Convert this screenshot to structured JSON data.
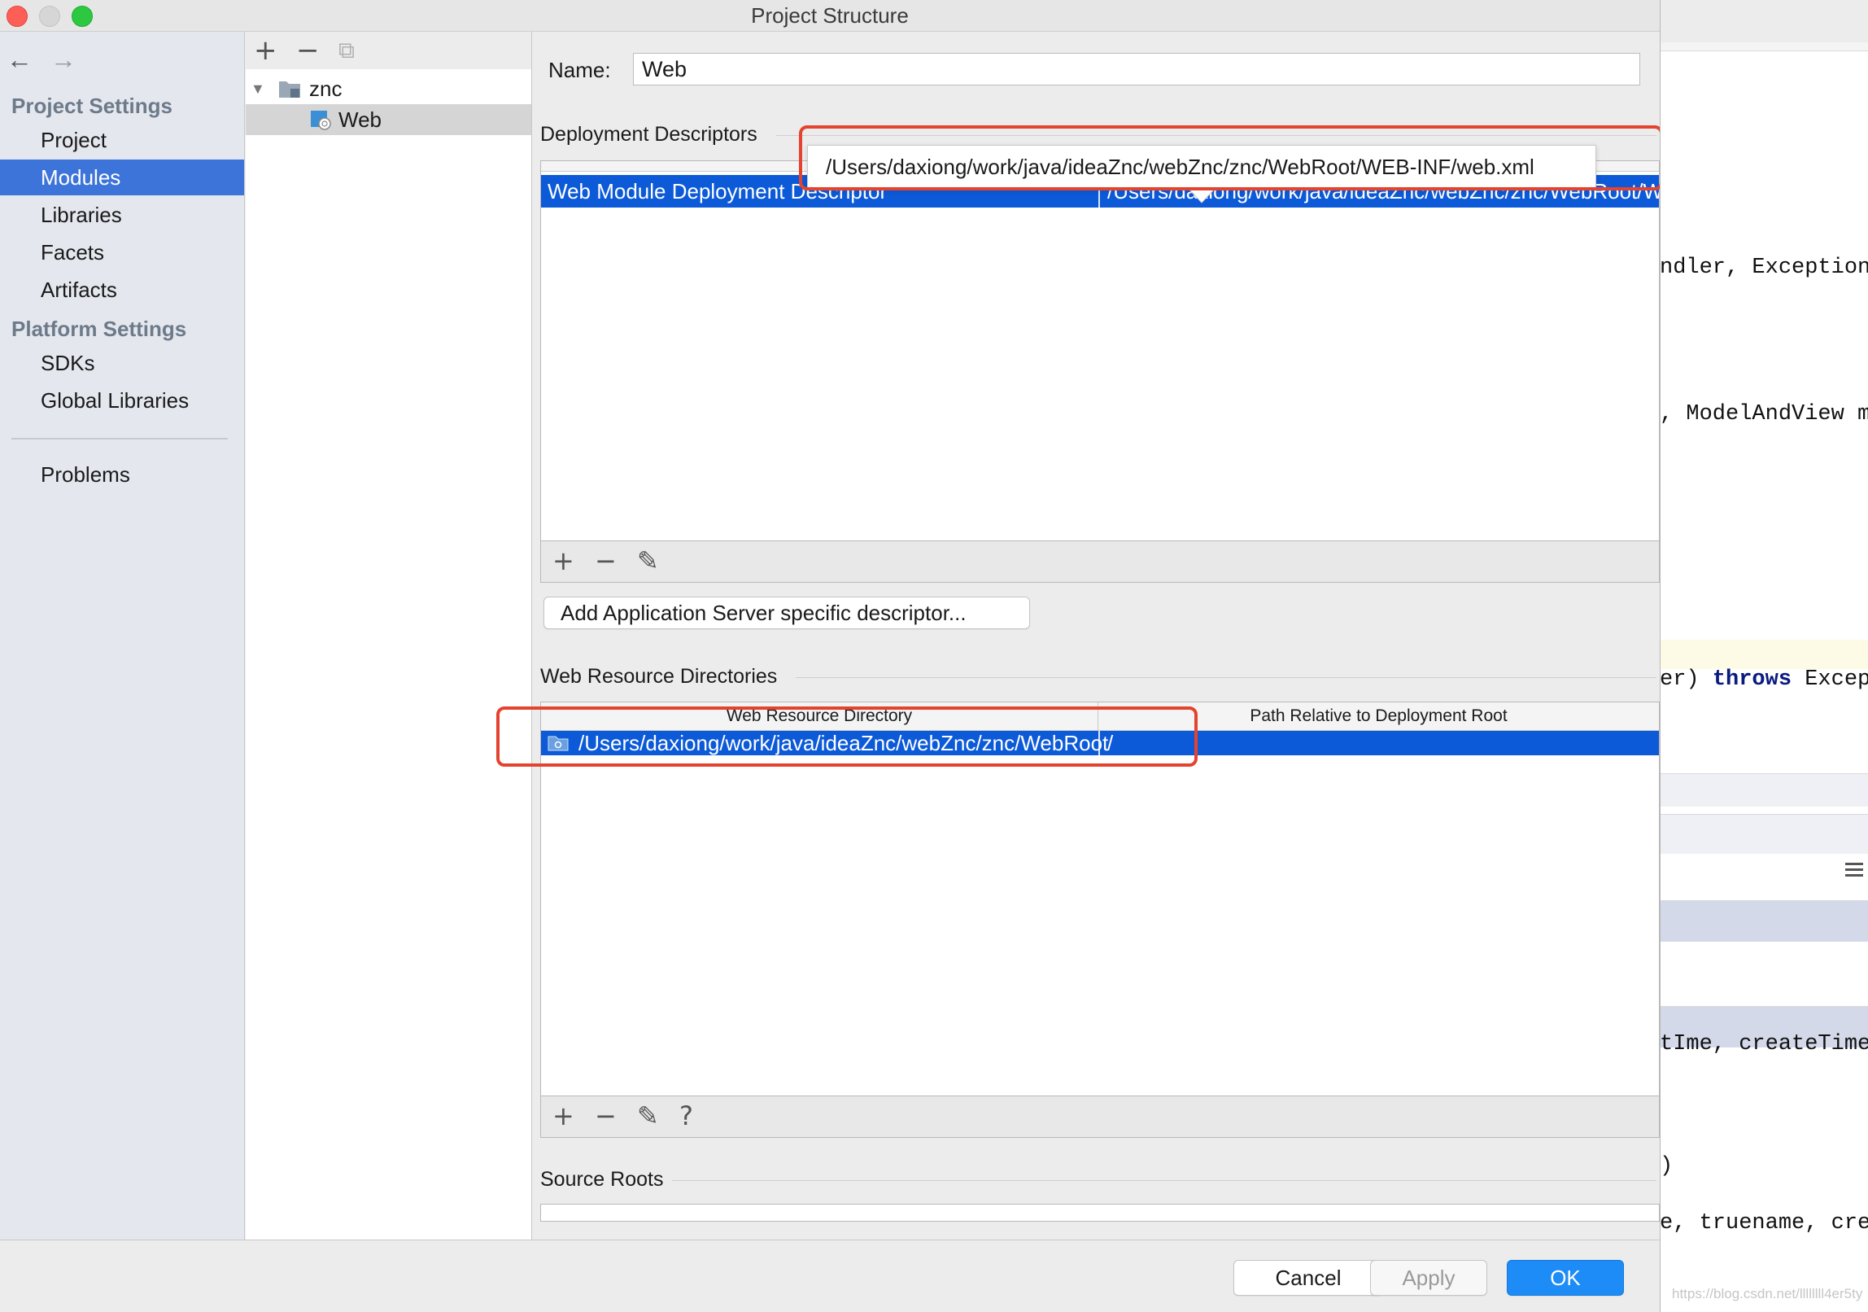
{
  "window": {
    "title": "Project Structure"
  },
  "nav": {
    "back": "←",
    "forward": "→",
    "project_settings_header": "Project Settings",
    "project_settings_items": [
      "Project",
      "Modules",
      "Libraries",
      "Facets",
      "Artifacts"
    ],
    "platform_settings_header": "Platform Settings",
    "platform_settings_items": [
      "SDKs",
      "Global Libraries"
    ],
    "problems": "Problems",
    "selected": "Modules"
  },
  "tree": {
    "toolbar": {
      "add": "+",
      "remove": "−",
      "copy": "⧉"
    },
    "root": "znc",
    "child": "Web"
  },
  "facet": {
    "name_label": "Name:",
    "name_value": "Web",
    "deployment_descriptors": {
      "section_title": "Deployment Descriptors",
      "tooltip": "/Users/daxiong/work/java/ideaZnc/webZnc/znc/WebRoot/WEB-INF/web.xml",
      "rows": [
        {
          "type": "Web Module Deployment Descriptor",
          "path": "/Users/daxiong/work/java/ideaZnc/webZnc/znc/WebRoot/WEB-INF/web.xml"
        }
      ],
      "toolbar": {
        "add": "+",
        "remove": "−",
        "edit": "✎"
      },
      "add_server_button": "Add Application Server specific descriptor..."
    },
    "web_resource_directories": {
      "section_title": "Web Resource Directories",
      "columns": [
        "Web Resource Directory",
        "Path Relative to Deployment Root"
      ],
      "rows": [
        {
          "directory": "/Users/daxiong/work/java/ideaZnc/webZnc/znc/WebRoot",
          "relative_path": "/"
        }
      ],
      "toolbar": {
        "add": "+",
        "remove": "−",
        "edit": "✎",
        "help": "?"
      }
    },
    "source_roots": {
      "section_title": "Source Roots"
    }
  },
  "footer": {
    "cancel": "Cancel",
    "apply": "Apply",
    "ok": "OK"
  },
  "background_editor": {
    "lines": [
      "ndler, Exception",
      ", ModelAndView m",
      "er) throws Excep",
      "tIme, createTime",
      ")",
      "e, truename, cre"
    ]
  },
  "watermark": "https://blog.csdn.net/llllllll4er5ty",
  "colors": {
    "selection": "#0c5ad8",
    "nav_selection": "#3d74d9",
    "primary_button": "#1e8cf6",
    "annotation": "#e4432f"
  }
}
